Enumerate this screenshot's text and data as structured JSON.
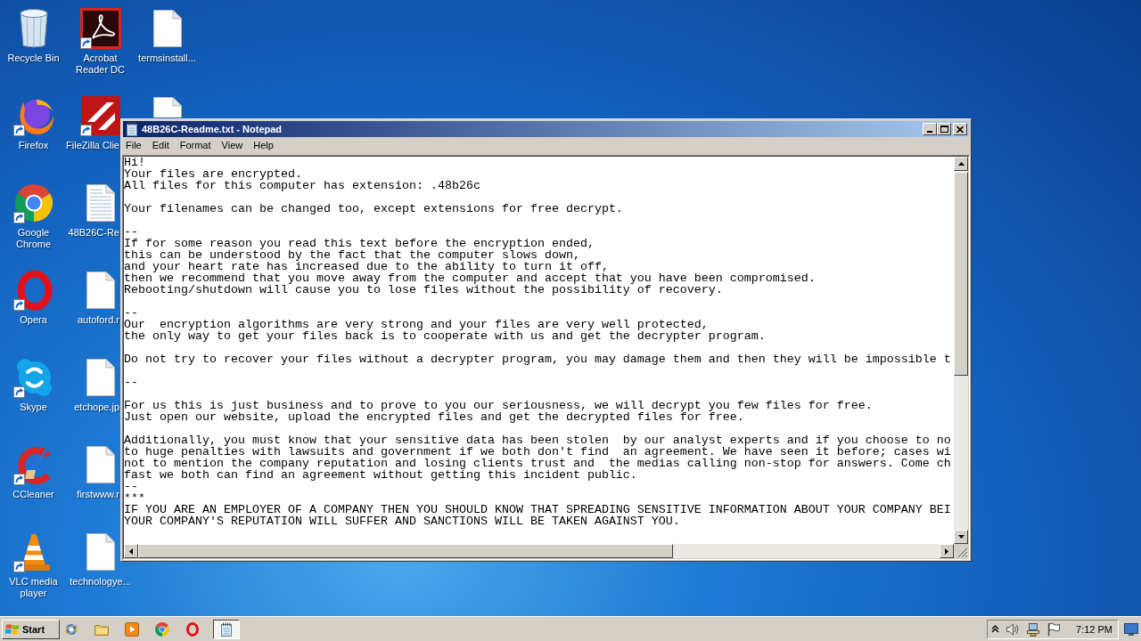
{
  "desktop": {
    "columns": [
      [
        {
          "kind": "trash",
          "label": "Recycle Bin",
          "covered": false
        },
        {
          "kind": "fox",
          "label": "Firefox",
          "covered": false
        },
        {
          "kind": "ring",
          "label": "Google Chrome",
          "covered": false
        },
        {
          "kind": "oval",
          "label": "Opera",
          "covered": false
        },
        {
          "kind": "cloud",
          "label": "Skype",
          "covered": false
        },
        {
          "kind": "arc",
          "label": "CCleaner",
          "covered": false
        },
        {
          "kind": "cone",
          "label": "VLC media player",
          "covered": false
        }
      ],
      [
        {
          "kind": "swirl",
          "label": "Acrobat Reader DC",
          "covered": false
        },
        {
          "kind": "tile",
          "label": "FileZilla Clie",
          "covered": true
        },
        {
          "kind": "notes",
          "label": "48B26C-Re",
          "covered": true
        },
        {
          "kind": "file",
          "label": "autoford.r",
          "covered": true
        },
        {
          "kind": "file",
          "label": "etchope.jp",
          "covered": true
        },
        {
          "kind": "file",
          "label": "firstwww.r",
          "covered": true
        },
        {
          "kind": "file",
          "label": "technologye...",
          "covered": false
        }
      ],
      [
        {
          "kind": "file",
          "label": "termsinstall...",
          "covered": false
        },
        {
          "kind": "file",
          "covered": true
        }
      ]
    ]
  },
  "notepad": {
    "title": "48B26C-Readme.txt - Notepad",
    "menu": [
      "File",
      "Edit",
      "Format",
      "View",
      "Help"
    ],
    "paragraphs": [
      {
        "lines": [
          "Hi!",
          "Your files are encrypted.",
          "All files for this computer has extension: .48b26c"
        ]
      },
      {
        "lines": [
          "Your filenames can be changed too, except extensions for free decrypt."
        ]
      },
      {
        "lines": [
          "--",
          "If for some reason you read this text before the encryption ended,",
          "this can be understood by the fact that the computer slows down,",
          "and your heart rate has increased due to the ability to turn it off,",
          "then we recommend that you move away from the computer and accept that you have been compromised.",
          "Rebooting/shutdown will cause you to lose files without the possibility of recovery."
        ]
      },
      {
        "lines": [
          "--",
          "Our  encryption algorithms are very strong and your files are very well protected,",
          "the only way to get your files back is to cooperate with us and get the decrypter program."
        ]
      },
      {
        "lines": [
          "Do not try to recover your files without a decrypter program, you may damage them and then they will be impossible t"
        ]
      },
      {
        "lines": [
          "--"
        ]
      },
      {
        "lines": [
          "For us this is just business and to prove to you our seriousness, we will decrypt you few files for free.",
          "Just open our website, upload the encrypted files and get the decrypted files for free."
        ]
      },
      {
        "lines": [
          "Additionally, you must know that your sensitive data has been stolen  by our analyst experts and if you choose to no",
          "to huge penalties with lawsuits and government if we both don't find  an agreement. We have seen it before; cases wi",
          "not to mention the company reputation and losing clients trust and  the medias calling non-stop for answers. Come ch",
          "fast we both can find an agreement without getting this incident public.",
          "--",
          "***",
          "IF YOU ARE AN EMPLOYER OF A COMPANY THEN YOU SHOULD KNOW THAT SPREADING SENSITIVE INFORMATION ABOUT YOUR COMPANY BEI",
          "YOUR COMPANY'S REPUTATION WILL SUFFER AND SANCTIONS WILL BE TAKEN AGAINST YOU."
        ]
      }
    ]
  },
  "taskbar": {
    "start": "Start",
    "tasks": [
      {
        "kind": "notepad",
        "selected": true
      }
    ],
    "clock": "7:12 PM"
  }
}
